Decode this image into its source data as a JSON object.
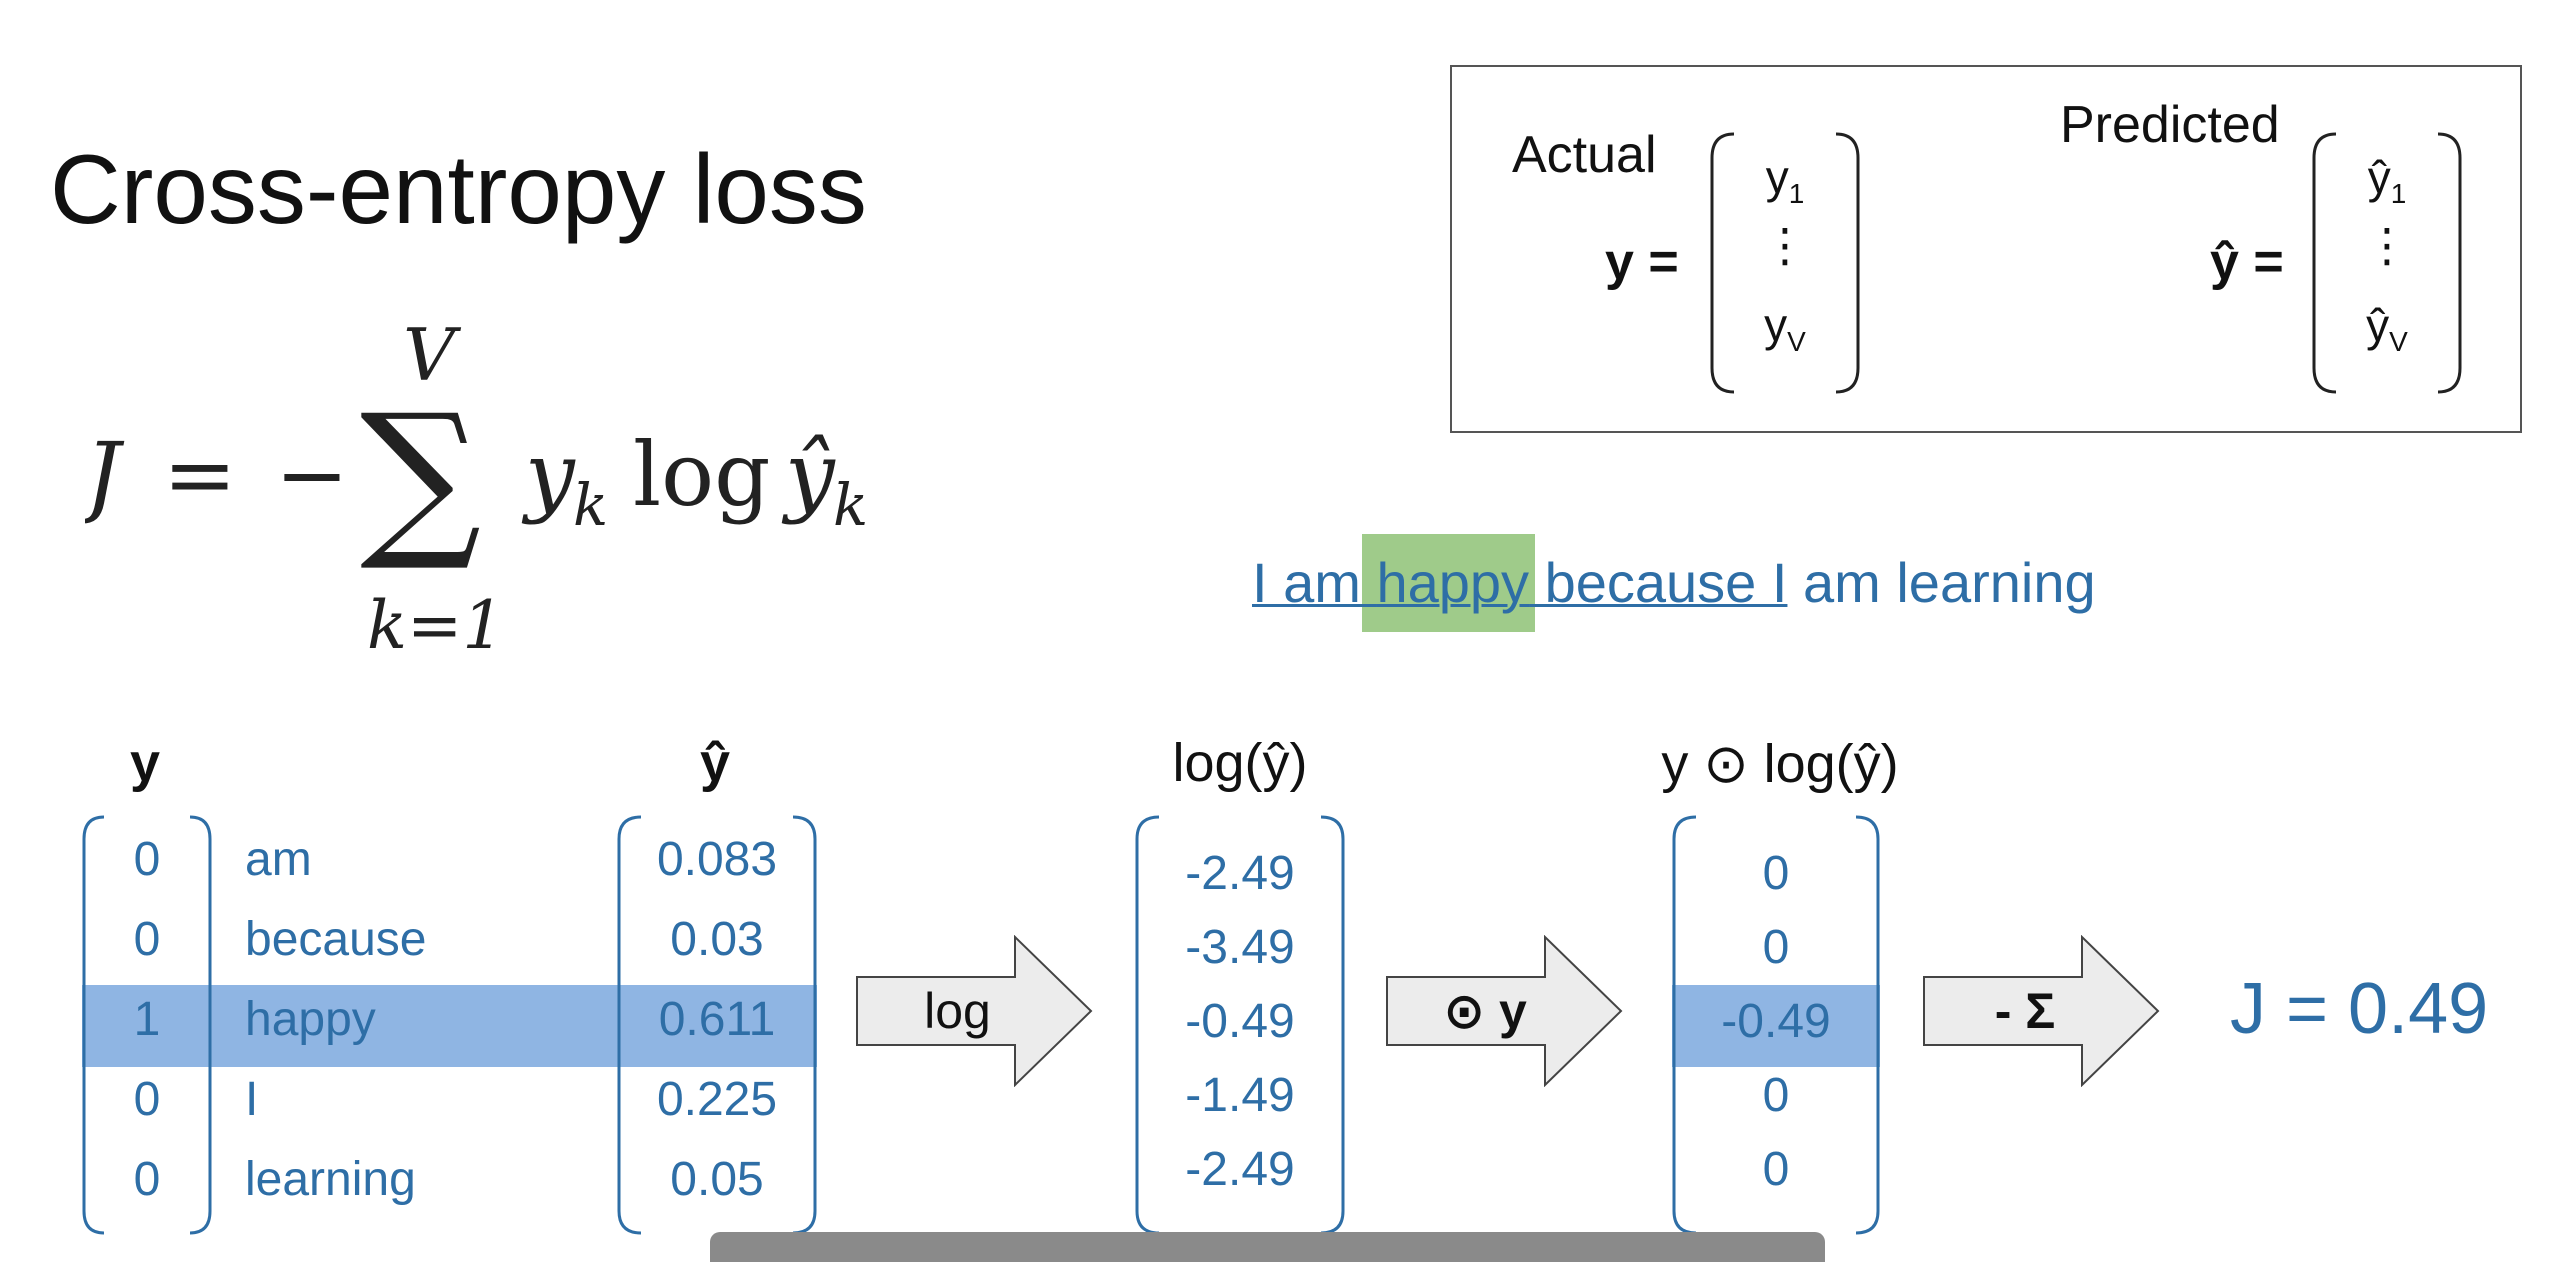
{
  "title": "Cross-entropy loss",
  "formula": {
    "lhs": "J",
    "equals": "=",
    "minus": "−",
    "sigma": "∑",
    "upper": "V",
    "lower": "k=1",
    "y": "y",
    "sub_k": "k",
    "log": "log",
    "yhat": "ŷ"
  },
  "definition_box": {
    "actual_label": "Actual",
    "predicted_label": "Predicted",
    "y_eq": "y =",
    "yhat_eq": "ŷ =",
    "y_first": "y",
    "y_first_sub": "1",
    "y_dots": "⋮",
    "y_last": "y",
    "y_last_sub": "V",
    "yhat_first": "ŷ",
    "yhat_first_sub": "1",
    "yhat_dots": "⋮",
    "yhat_last": "ŷ",
    "yhat_last_sub": "V"
  },
  "sentence": {
    "part1": "I am ",
    "highlight": "happy",
    "part2": " because I",
    "part3": " am learning"
  },
  "headers": {
    "y": "y",
    "yhat": "ŷ",
    "log_yhat": "log(ŷ)",
    "y_odot_log": "y ⊙ log(ŷ)"
  },
  "y_values": [
    "0",
    "0",
    "1",
    "0",
    "0"
  ],
  "words": [
    "am",
    "because",
    "happy",
    "I",
    "learning"
  ],
  "yhat_values": [
    "0.083",
    "0.03",
    "0.611",
    "0.225",
    "0.05"
  ],
  "log_values": [
    "-2.49",
    "-3.49",
    "-0.49",
    "-1.49",
    "-2.49"
  ],
  "product_values": [
    "0",
    "0",
    "-0.49",
    "0",
    "0"
  ],
  "arrows": {
    "log": "log",
    "odot_y": "⊙ y",
    "neg_sum": "- Σ"
  },
  "result": "J = 0.49",
  "colors": {
    "accent_blue": "#2e6ea6",
    "highlight_band": "#8fb5e3",
    "word_highlight": "#9fcb8a",
    "arrow_fill": "#ececec"
  }
}
